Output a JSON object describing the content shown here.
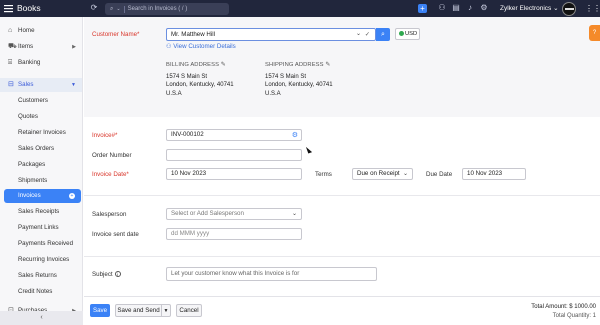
{
  "topbar": {
    "app_name": "Books",
    "search_placeholder": "Search in Invoices ( / )",
    "org_name": "Zylker Electronics",
    "org_caret": "⌄"
  },
  "sidebar": {
    "items": [
      {
        "label": "Home",
        "icon": "home-icon"
      },
      {
        "label": "Items",
        "icon": "cart-icon"
      },
      {
        "label": "Banking",
        "icon": "bank-icon"
      },
      {
        "label": "Sales",
        "icon": "sales-icon"
      },
      {
        "label": "Customers"
      },
      {
        "label": "Quotes"
      },
      {
        "label": "Retainer Invoices"
      },
      {
        "label": "Sales Orders"
      },
      {
        "label": "Packages"
      },
      {
        "label": "Shipments"
      },
      {
        "label": "Invoices"
      },
      {
        "label": "Sales Receipts"
      },
      {
        "label": "Payment Links"
      },
      {
        "label": "Payments Received"
      },
      {
        "label": "Recurring Invoices"
      },
      {
        "label": "Sales Returns"
      },
      {
        "label": "Credit Notes"
      },
      {
        "label": "Purchases"
      }
    ],
    "collapse_label": "‹"
  },
  "customer": {
    "label": "Customer Name*",
    "value": "Mr. Matthew Hill",
    "currency": "USD",
    "view_link": "View Customer Details"
  },
  "billing": {
    "heading": "BILLING ADDRESS",
    "lines": [
      "1574 S Main St",
      "London, Kentucky, 40741",
      "U.S.A"
    ]
  },
  "shipping": {
    "heading": "SHIPPING ADDRESS",
    "lines": [
      "1574 S Main St",
      "London, Kentucky, 40741",
      "U.S.A"
    ]
  },
  "invoice": {
    "number_label": "Invoice#*",
    "number_value": "INV-000102",
    "order_label": "Order Number",
    "order_value": "",
    "date_label": "Invoice Date*",
    "date_value": "10 Nov 2023",
    "terms_label": "Terms",
    "terms_value": "Due on Receipt",
    "due_label": "Due Date",
    "due_value": "10 Nov 2023",
    "salesperson_label": "Salesperson",
    "salesperson_placeholder": "Select or Add Salesperson",
    "sent_label": "Invoice sent date",
    "sent_placeholder": "dd MMM yyyy",
    "subject_label": "Subject",
    "subject_placeholder": "Let your customer know what this Invoice is for"
  },
  "footer": {
    "save": "Save",
    "save_send": "Save and Send",
    "cancel": "Cancel",
    "total_amount": "Total Amount: $ 1000.00",
    "total_quantity": "Total Quantity: 1"
  },
  "colors": {
    "accent": "#3b82f6",
    "topbar": "#21263c",
    "required": "#d9362b"
  }
}
